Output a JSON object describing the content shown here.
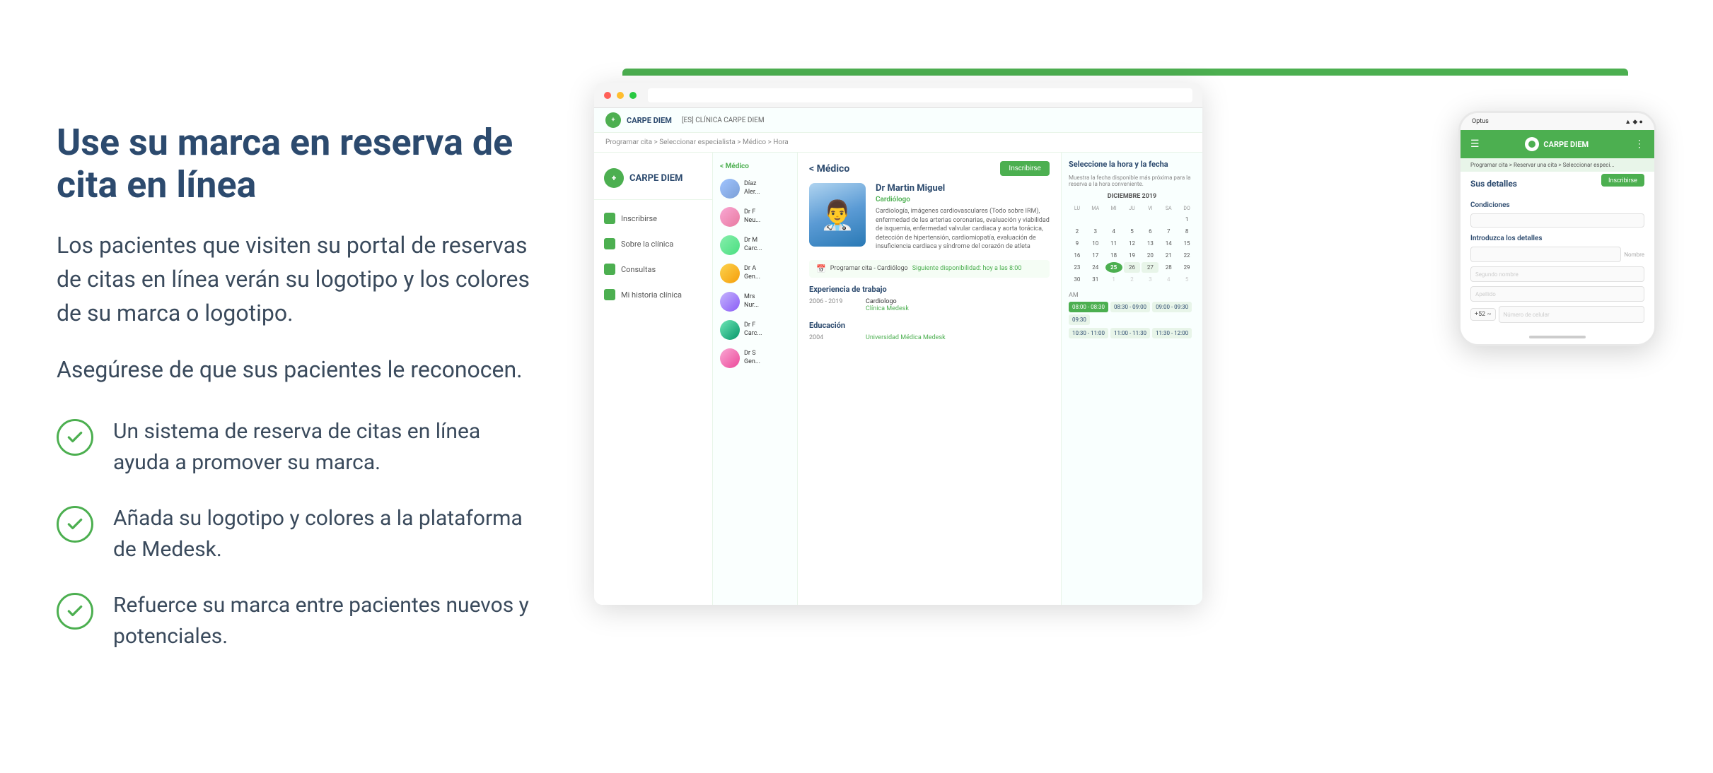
{
  "page": {
    "background": "#ffffff"
  },
  "left": {
    "main_title": "Use su marca en reserva de cita en línea",
    "description_1": "Los pacientes que visiten su portal de reservas de citas en línea verán su logotipo y los colores de su marca o logotipo.",
    "description_2": "Asegúrese de que sus pacientes le reconocen.",
    "features": [
      {
        "id": "feature-1",
        "text": "Un sistema de reserva de citas en línea ayuda a promover su marca."
      },
      {
        "id": "feature-2",
        "text": "Añada su logotipo y colores a la plataforma de Medesk."
      },
      {
        "id": "feature-3",
        "text": "Refuerce su marca entre pacientes nuevos y potenciales."
      }
    ]
  },
  "browser": {
    "clinic_name": "[ES] CLÍNICA CARPE DIEM",
    "brand_name": "CARPE DIEM",
    "breadcrumb": "Programar cita > Seleccionar especialista > Médico > Hora",
    "sidebar_items": [
      {
        "label": "Inscribirse"
      },
      {
        "label": "Sobre la clínica"
      },
      {
        "label": "Consultas"
      },
      {
        "label": "Mi historia clínica"
      }
    ],
    "doctors_header": "< Médico",
    "doctors": [
      {
        "name": "Díaz\nAler...",
        "av": "av1"
      },
      {
        "name": "Dr F\nNeu...",
        "av": "av2"
      },
      {
        "name": "Dr M\nCarc...",
        "av": "av3"
      },
      {
        "name": "Dr A\nGen...",
        "av": "av4"
      },
      {
        "name": "Mrs\nNur...",
        "av": "av5"
      },
      {
        "name": "Dr F\nCarc...",
        "av": "av6"
      },
      {
        "name": "Dr S\nGen...",
        "av": "av7"
      }
    ],
    "profile": {
      "title": "< Médico",
      "inscribirse": "Inscribirse",
      "doctor_name": "Dr Martin Miguel",
      "specialty": "Cardiólogo",
      "description": "Cardiología, imágenes cardiovasculares (Todo sobre IRM), enfermedad de las arterias coronarias, evaluación y viabilidad de isquemia, enfermedad valvular cardiaca y aorta torácica, detección de hipertensión, cardiomiopatía, evaluación de insuficiencia cardiaca y síndrome del corazón de atleta",
      "schedule_label": "Programar cita - Cardiólogo",
      "schedule_available": "Siguiente disponibilidad: hoy a las 8:00",
      "work_title": "Experiencia de trabajo",
      "work_items": [
        {
          "years": "2006 - 2019",
          "role": "Cardiologo",
          "clinic": "Clínica Medesk"
        }
      ],
      "edu_title": "Educación",
      "edu_items": [
        {
          "year": "2004",
          "place": "Universidad Médica Medesk"
        }
      ]
    },
    "calendar": {
      "title": "Seleccione la hora y la fecha",
      "hint": "Muestra la fecha disponible más próxima para la reserva a la hora conveniente.",
      "month": "DICIEMBRE 2019",
      "day_headers": [
        "LU",
        "MA",
        "MI",
        "JU",
        "VI",
        "SA",
        "DO"
      ],
      "weeks": [
        [
          "",
          "",
          "",
          "",
          "",
          "",
          "1"
        ],
        [
          "2",
          "3",
          "4",
          "5",
          "6",
          "7",
          "8"
        ],
        [
          "9",
          "10",
          "11",
          "12",
          "13",
          "14",
          "15"
        ],
        [
          "16",
          "17",
          "18",
          "19",
          "20",
          "21",
          "22"
        ],
        [
          "23",
          "24",
          "25",
          "26",
          "27",
          "28",
          "29"
        ],
        [
          "30",
          "31",
          "1",
          "2",
          "3",
          "4",
          "5"
        ]
      ],
      "today_day": "25",
      "near_days": [
        "26",
        "27"
      ],
      "time_label": "AM",
      "time_slots": [
        {
          "label": "08:00 - 08:30",
          "selected": true
        },
        {
          "label": "08:30 - 09:00",
          "selected": false
        },
        {
          "label": "09:00 - 09:30",
          "selected": false
        },
        {
          "label": "09:30",
          "selected": false
        },
        {
          "label": "10:30 - 11:00",
          "selected": false
        },
        {
          "label": "11:00 - 11:30",
          "selected": false
        },
        {
          "label": "11:30 - 12:00",
          "selected": false
        }
      ]
    }
  },
  "mobile": {
    "carrier": "Optus",
    "signal": "▲ ◆ ●",
    "brand": "CARPE DIEM",
    "breadcrumb": "Programar cita > Reservar una cita > Seleccionar especi...",
    "section_title": "Sus detalles",
    "inscribirse": "Inscribirse",
    "conditions_label": "Condiciones",
    "details_label": "Introduzca los detalles",
    "fields": {
      "nombre_placeholder": "Nombre",
      "segundo_nombre_placeholder": "Segundo nombre",
      "apellido_placeholder": "Apellido",
      "phone_code": "+52 ~",
      "phone_placeholder": "Número de celular"
    }
  }
}
